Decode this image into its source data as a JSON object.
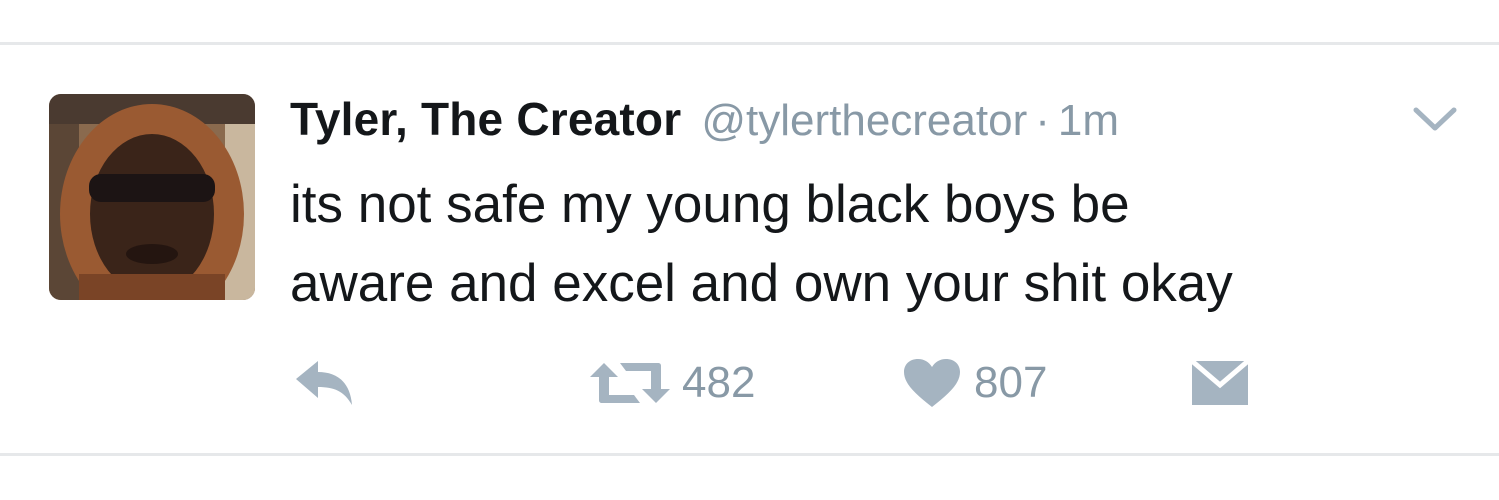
{
  "tweet": {
    "display_name": "Tyler, The Creator",
    "handle": "@tylerthecreator",
    "separator": "·",
    "time": "1m",
    "text_lines": [
      "its not safe my young black boys be",
      "aware and excel and own your shit okay"
    ]
  },
  "actions": {
    "reply_icon": "reply-icon",
    "retweet_icon": "retweet-icon",
    "retweet_count": "482",
    "like_icon": "heart-icon",
    "like_count": "807",
    "dm_icon": "envelope-icon"
  },
  "colors": {
    "text": "#14171a",
    "secondary": "#8899a6",
    "icon": "#a5b4c1",
    "divider": "#e6e8ea"
  }
}
